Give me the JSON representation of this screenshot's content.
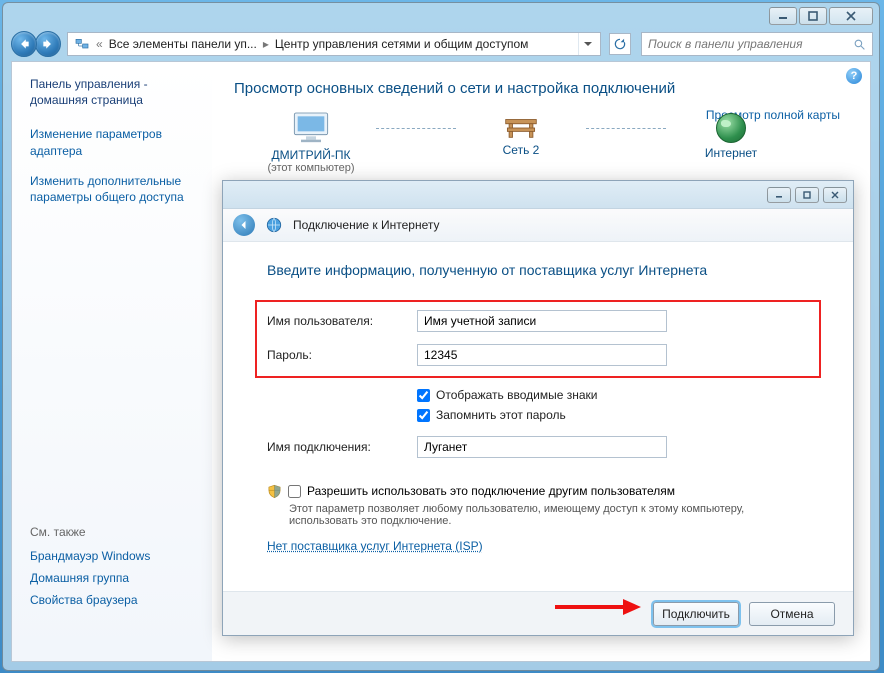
{
  "breadcrumb": {
    "item1": "Все элементы панели уп...",
    "item2": "Центр управления сетями и общим доступом"
  },
  "search": {
    "placeholder": "Поиск в панели управления"
  },
  "sidebar": {
    "home": "Панель управления - домашняя страница",
    "links": [
      "Изменение параметров адаптера",
      "Изменить дополнительные параметры общего доступа"
    ],
    "see_also": "См. также",
    "sub": [
      "Брандмауэр Windows",
      "Домашняя группа",
      "Свойства браузера"
    ]
  },
  "main": {
    "title": "Просмотр основных сведений о сети и настройка подключений",
    "node_pc": "ДМИТРИЙ-ПК",
    "node_pc_sub": "(этот компьютер)",
    "node_net": "Сеть 2",
    "node_inet": "Интернет",
    "full_map": "Просмотр полной карты"
  },
  "dialog": {
    "wizard_title": "Подключение к Интернету",
    "heading": "Введите информацию, полученную от поставщика услуг Интернета",
    "user_label": "Имя пользователя:",
    "user_value": "Имя учетной записи",
    "pass_label": "Пароль:",
    "pass_value": "12345",
    "show_chars": "Отображать вводимые знаки",
    "remember": "Запомнить этот пароль",
    "conn_label": "Имя подключения:",
    "conn_value": "Луганет",
    "allow_others": "Разрешить использовать это подключение другим пользователям",
    "allow_hint": "Этот параметр позволяет любому пользователю, имеющему доступ к этому компьютеру, использовать это подключение.",
    "isp_link": "Нет поставщика услуг Интернета (ISP)",
    "btn_connect": "Подключить",
    "btn_cancel": "Отмена"
  }
}
